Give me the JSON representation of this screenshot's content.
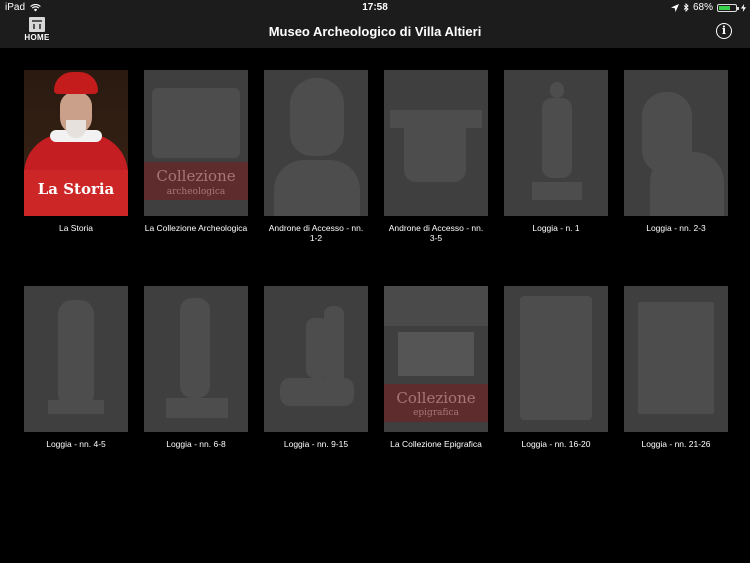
{
  "status_bar": {
    "device": "iPad",
    "time": "17:58",
    "battery": "68%",
    "battery_level": 0.68
  },
  "nav": {
    "home_label": "HOME",
    "title": "Museo Archeologico di Villa Altieri"
  },
  "tiles": [
    {
      "caption": "La Storia",
      "overlay": "La Storia"
    },
    {
      "caption": "La Collezione Archeologica",
      "overlay": "Collezione",
      "overlay_sub": "archeologica"
    },
    {
      "caption": "Androne di Accesso - nn. 1-2"
    },
    {
      "caption": "Androne di Accesso - nn. 3-5"
    },
    {
      "caption": "Loggia - n. 1"
    },
    {
      "caption": "Loggia - nn. 2-3"
    },
    {
      "caption": "Loggia - nn. 4-5"
    },
    {
      "caption": "Loggia - nn. 6-8"
    },
    {
      "caption": "Loggia - nn. 9-15"
    },
    {
      "caption": "La Collezione Epigrafica",
      "overlay": "Collezione",
      "overlay_sub": "epigrafica"
    },
    {
      "caption": "Loggia - nn. 16-20"
    },
    {
      "caption": "Loggia - nn. 21-26"
    }
  ]
}
